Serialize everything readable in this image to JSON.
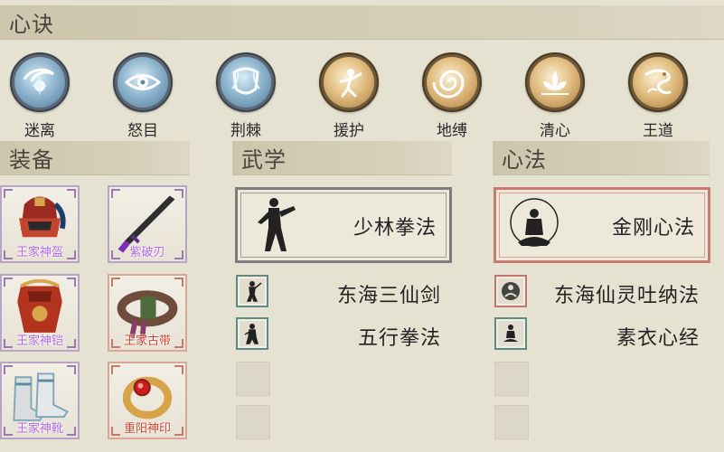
{
  "headers": {
    "xinjue": "心诀",
    "zhuangbei": "装备",
    "wuxue": "武学",
    "xinfa": "心法"
  },
  "skills": [
    {
      "label": "迷离",
      "theme": "blue"
    },
    {
      "label": "怒目",
      "theme": "blue"
    },
    {
      "label": "荆棘",
      "theme": "blue"
    },
    {
      "label": "援护",
      "theme": "gold"
    },
    {
      "label": "地缚",
      "theme": "gold"
    },
    {
      "label": "清心",
      "theme": "gold"
    },
    {
      "label": "王道",
      "theme": "gold"
    }
  ],
  "equipment": [
    {
      "name": "王家神盔",
      "rarity": "purple"
    },
    {
      "name": "紫破刃",
      "rarity": "purple"
    },
    {
      "name": "王家神铠",
      "rarity": "purple"
    },
    {
      "name": "王家古带",
      "rarity": "red"
    },
    {
      "name": "王家神靴",
      "rarity": "purple"
    },
    {
      "name": "重阳神印",
      "rarity": "red"
    }
  ],
  "wuxue": {
    "main": "少林拳法",
    "list": [
      "东海三仙剑",
      "五行拳法"
    ]
  },
  "xinfa": {
    "main": "金刚心法",
    "list": [
      "东海仙灵吐纳法",
      "素衣心经"
    ]
  },
  "colors": {
    "purple_rarity": "#b06ae0",
    "red_rarity": "#d2452d",
    "background": "#e6e2d2"
  }
}
